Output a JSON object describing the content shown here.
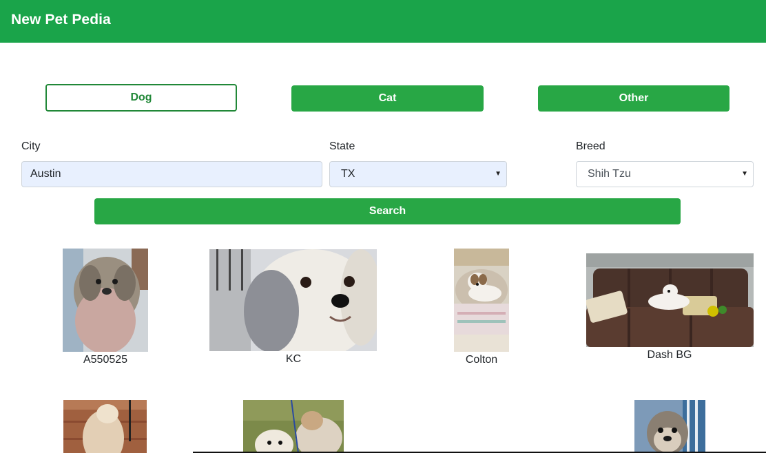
{
  "navbar": {
    "brand": "New Pet Pedia",
    "color": "#1aa44a"
  },
  "pet_types": [
    {
      "label": "Dog",
      "selected": true
    },
    {
      "label": "Cat",
      "selected": false
    },
    {
      "label": "Other",
      "selected": false
    }
  ],
  "filters": {
    "city": {
      "label": "City",
      "value": "Austin"
    },
    "state": {
      "label": "State",
      "value": "TX"
    },
    "breed": {
      "label": "Breed",
      "value": "Shih Tzu"
    }
  },
  "search_label": "Search",
  "pets": [
    {
      "name": "A550525"
    },
    {
      "name": "KC"
    },
    {
      "name": "Colton"
    },
    {
      "name": "Dash BG"
    }
  ],
  "colors": {
    "accent": "#28a745",
    "outline": "#218838"
  }
}
